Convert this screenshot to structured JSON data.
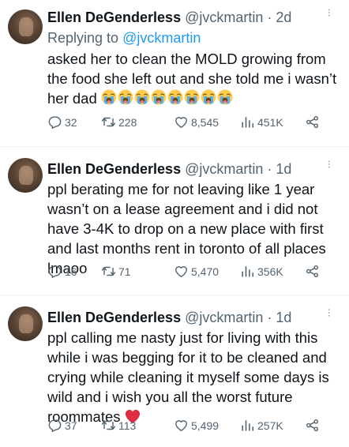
{
  "tweets": [
    {
      "name": "Ellen DeGenderless",
      "handle": "@jvckmartin",
      "sep": "·",
      "time": "2d",
      "replying_prefix": "Replying to",
      "replying_to": "@jvckmartin",
      "text": "asked her to clean the MOLD growing from the food she left out and she told me i wasn’t her dad",
      "emoji_count": 8,
      "emoji_name": "loudly-crying-face",
      "replies": "32",
      "retweets": "228",
      "likes": "8,545",
      "views": "451K"
    },
    {
      "name": "Ellen DeGenderless",
      "handle": "@jvckmartin",
      "sep": "·",
      "time": "1d",
      "text": "ppl berating me for not leaving like 1 year wasn’t on a lease agreement and i did not have 3-4K to drop on a new place with first and last months rent in toronto of all places lmaoo",
      "replies": "16",
      "retweets": "71",
      "likes": "5,470",
      "views": "356K"
    },
    {
      "name": "Ellen DeGenderless",
      "handle": "@jvckmartin",
      "sep": "·",
      "time": "1d",
      "text": "ppl calling me nasty just for living with this while i was begging for it to be cleaned and crying while cleaning it myself some days is wild and i wish you all the worst future roommates",
      "emoji_name": "red-heart",
      "replies": "37",
      "retweets": "113",
      "likes": "5,499",
      "views": "257K"
    }
  ],
  "more_glyph": "···",
  "colors": {
    "text": "#0f1419",
    "secondary": "#536471",
    "link": "#1d9bf0",
    "divider": "#eff3f4",
    "heart": "#e0245e",
    "emoji_face": "#ffcc4d",
    "emoji_tear": "#5dadec"
  }
}
